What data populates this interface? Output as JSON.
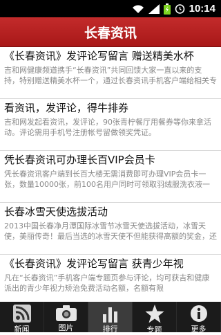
{
  "status_bar": {
    "time": "10:14"
  },
  "header": {
    "title": "长春资讯"
  },
  "articles": [
    {
      "title": "《长春资讯》发评论写留言 赠送精美水杯",
      "summary": "吉和网健康频道携手“长春资讯”共同回馈大家一直以来的支持，特别赠送精美水杯一个，通过长春资讯手机客户端给相关专题页活动文章评论留言，评论时请一定要使用手"
    },
    {
      "title": "看资讯，发评论，得牛排券",
      "summary": "吉和网发起看资讯，发评论，90张青柠餐厅用餐券等你来拿活动。评论需用手机号注册帐号留做领奖凭证。"
    },
    {
      "title": "凭长春资讯可办理长百VIP会员卡",
      "summary": "凭长春资讯客户端到长百大楼无需消费即可办理VIP会员卡一张，数量10000张，前100名用户同时可领取羽绒服洗衣液一瓶"
    },
    {
      "title": "长春冰雪天使选拔活动",
      "summary": "2013中国长春净月潭国际冰雪节冰雪天使选拔活动，冰雪天使，美丽传奇！最后当选的冰雪天使不但能获得高额的奖金，还会作为代表净月，代表长春，代表中国，飞往瑞典，飞"
    },
    {
      "title": "《长春资讯》发评论写留言 获青少年视",
      "summary": "凡在“长春资讯”手机客户端专题页参与评论，均可获吉和健康派出的青少年视力矫治免费活动名额，名额有限"
    }
  ],
  "tabs": [
    {
      "label": "新闻",
      "icon": "rss-icon"
    },
    {
      "label": "图片",
      "icon": "camera-icon"
    },
    {
      "label": "排行",
      "icon": "bar-chart-icon"
    },
    {
      "label": "专题",
      "icon": "star-icon"
    },
    {
      "label": "更多",
      "icon": "info-icon"
    }
  ],
  "colors": {
    "header_red": "#b82020",
    "tab_bar": "#1b1b1b",
    "active_tab": "#3c3c3c"
  }
}
